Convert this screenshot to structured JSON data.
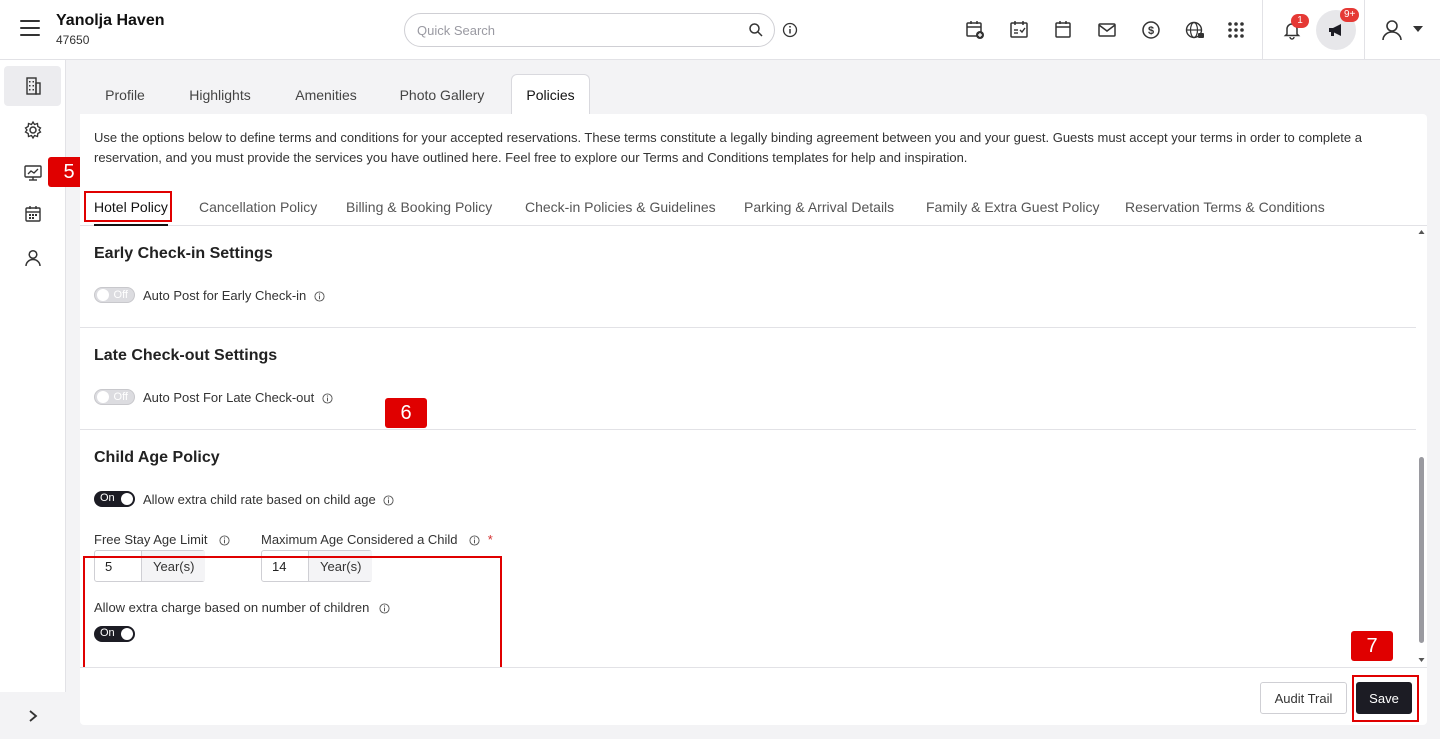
{
  "header": {
    "property_name": "Yanolja Haven",
    "property_id": "47650",
    "search_placeholder": "Quick Search",
    "notification_count": "1",
    "announcement_count": "9+"
  },
  "main_tabs": [
    "Profile",
    "Highlights",
    "Amenities",
    "Photo Gallery",
    "Policies"
  ],
  "active_main_tab": "Policies",
  "intro_text": "Use the options below to define terms and conditions for your accepted reservations. These terms constitute a legally binding agreement between you and your guest. Guests must accept your terms in order to complete a reservation, and you must provide the services you have outlined here. Feel free to explore our Terms and Conditions templates for help and inspiration.",
  "policy_tabs": [
    "Hotel Policy",
    "Cancellation Policy",
    "Billing & Booking Policy",
    "Check-in Policies & Guidelines",
    "Parking & Arrival Details",
    "Family & Extra Guest Policy",
    "Reservation Terms & Conditions"
  ],
  "active_policy_tab": "Hotel Policy",
  "early_checkin": {
    "title": "Early Check-in Settings",
    "toggle_state": "Off",
    "label": "Auto Post for Early Check-in"
  },
  "late_checkout": {
    "title": "Late Check-out Settings",
    "toggle_state": "Off",
    "label": "Auto Post For Late Check-out"
  },
  "child_age_policy": {
    "title": "Child Age Policy",
    "extra_rate_toggle": "On",
    "extra_rate_label": "Allow extra child rate based on child age",
    "free_stay_label": "Free Stay Age Limit",
    "free_stay_value": "5",
    "free_stay_unit": "Year(s)",
    "max_age_label": "Maximum Age Considered a Child",
    "max_age_required": "*",
    "max_age_value": "14",
    "max_age_unit": "Year(s)",
    "extra_charge_label": "Allow extra charge based on number of children",
    "extra_charge_toggle": "On"
  },
  "footer": {
    "audit_trail_label": "Audit Trail",
    "save_label": "Save"
  },
  "step_markers": [
    "5",
    "6",
    "7"
  ],
  "colors": {
    "accent_dark": "#1c1c24",
    "highlight_red": "#e00000",
    "badge_red": "#e53935"
  }
}
